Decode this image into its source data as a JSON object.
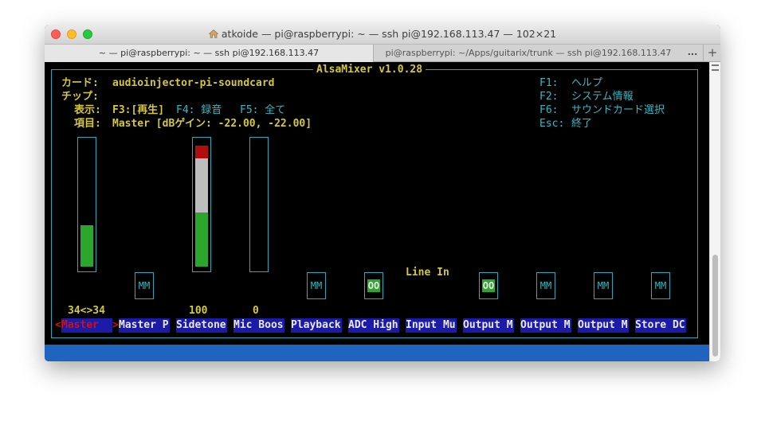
{
  "window": {
    "title": "atkoide — pi@raspberrypi: ~ — ssh pi@192.168.113.47 — 102×21"
  },
  "tabs": [
    {
      "label": "~ — pi@raspberrypi: ~ — ssh pi@192.168.113.47"
    },
    {
      "label": "pi@raspberrypi: ~/Apps/guitarix/trunk — ssh pi@192.168.113.47"
    }
  ],
  "tab_more": "...",
  "tab_add": "+",
  "mixer": {
    "title": "AlsaMixer v1.0.28",
    "info": {
      "card_label": "カード:",
      "card_value": "audioinjector-pi-soundcard",
      "chip_label": "チップ:",
      "view_label": "表示:",
      "view_f3": "F3:[再生]",
      "view_f4": "F4: 録音",
      "view_f5": "F5: 全て",
      "item_label": "項目:",
      "item_value": "Master [dBゲイン: -22.00, -22.00]"
    },
    "help": [
      {
        "key": "F1:",
        "text": "ヘルプ"
      },
      {
        "key": "F2:",
        "text": "システム情報"
      },
      {
        "key": "F6:",
        "text": "サウンドカード選択"
      },
      {
        "key": "Esc:",
        "text": "終了"
      }
    ],
    "line_in_label": "Line In",
    "switches": {
      "master_p": "MM",
      "playback": "MM",
      "adc_high": "OO",
      "line_in": "OO",
      "output_m1": "MM",
      "output_m2": "MM",
      "store_dc": "MM"
    },
    "values": {
      "master": "34<>34",
      "sidetone": "100",
      "mic_boost": "0"
    },
    "levels": {
      "master": 0.34,
      "sidetone": 1.0,
      "mic_boost": 0.0
    },
    "selection_marks": {
      "left": "<",
      "right": ">"
    },
    "channels": [
      "Master",
      "Master P",
      "Sidetone",
      "Mic Boos",
      "Playback",
      "ADC High",
      "Input Mu",
      "Output M",
      "Output M",
      "Output M",
      "Store DC"
    ]
  }
}
